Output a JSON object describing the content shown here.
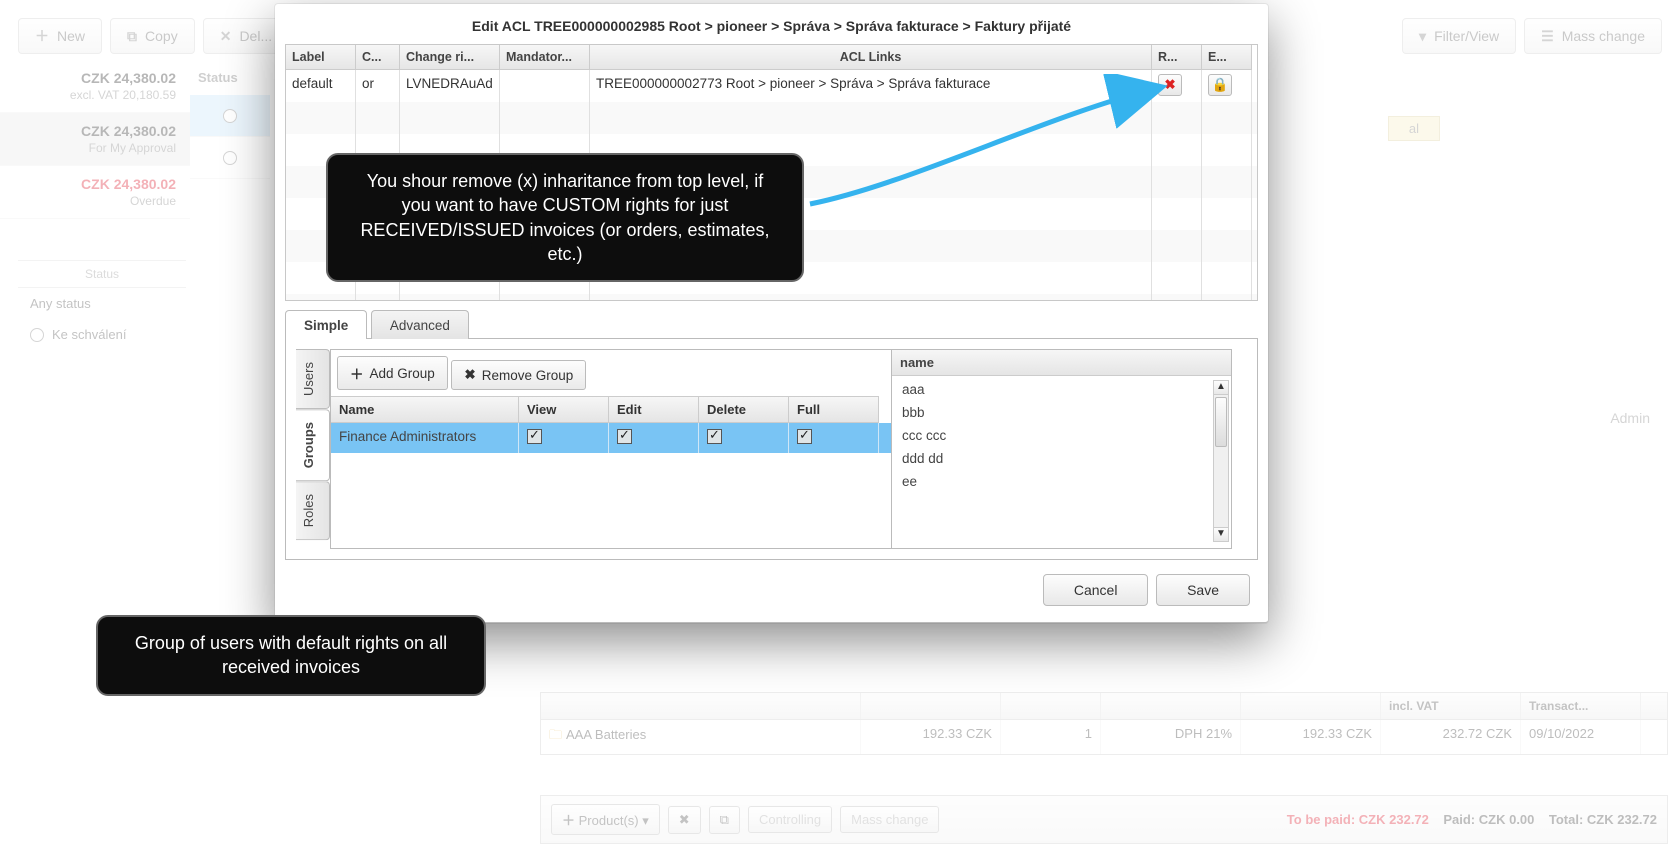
{
  "toolbar": {
    "new": "New",
    "copy": "Copy",
    "del": "Del...",
    "filter": "Filter/View",
    "mass": "Mass change"
  },
  "summaries": [
    {
      "amt": "CZK 24,380.02",
      "sub": "excl. VAT 20,180.59"
    },
    {
      "amt": "CZK 24,380.02",
      "sub": "For My Approval"
    },
    {
      "amt": "CZK 24,380.02",
      "sub": "Overdue",
      "red": true
    }
  ],
  "status_label": "Status",
  "status_filter": {
    "title": "Status",
    "any": "Any status",
    "ke": "Ke schválení"
  },
  "right_bg": {
    "al": "al",
    "admin": "Admin"
  },
  "items": {
    "headers": [
      "",
      "",
      "",
      "",
      "",
      "incl. VAT",
      "Transact..."
    ],
    "row": {
      "name": "AAA Batteries",
      "price": "192.33 CZK",
      "qty": "1",
      "vat": "DPH 21%",
      "total": "192.33 CZK",
      "incl": "232.72 CZK",
      "date": "09/10/2022"
    },
    "foot": {
      "products": "Product(s)",
      "controlling": "Controlling",
      "mass": "Mass change",
      "to_be_paid_label": "To be paid:",
      "to_be_paid": "CZK 232.72",
      "paid_label": "Paid:",
      "paid": "CZK 0.00",
      "total_label": "Total:",
      "total": "CZK 232.72"
    }
  },
  "modal": {
    "title": "Edit ACL TREE000000002985 Root > pioneer > Správa > Správa fakturace > Faktury přijaté",
    "cols": {
      "label": "Label",
      "cond": "C...",
      "change": "Change ri...",
      "mandator": "Mandator...",
      "links": "ACL Links",
      "r": "R...",
      "e": "E..."
    },
    "row": {
      "label": "default",
      "cond": "or",
      "change": "LVNEDRAuAd",
      "mandator": "",
      "links": "TREE000000002773 Root > pioneer > Správa > Správa fakturace"
    },
    "tabs": {
      "simple": "Simple",
      "advanced": "Advanced"
    },
    "vtabs": {
      "users": "Users",
      "groups": "Groups",
      "roles": "Roles"
    },
    "actions": {
      "add": "Add Group",
      "remove": "Remove Group"
    },
    "grp_headers": {
      "name": "Name",
      "view": "View",
      "edit": "Edit",
      "delete": "Delete",
      "full": "Full"
    },
    "grp_row": {
      "name": "Finance Administrators"
    },
    "names_header": "name",
    "names": [
      "aaa",
      "bbb",
      "ccc ccc",
      "ddd dd",
      "ee"
    ],
    "buttons": {
      "cancel": "Cancel",
      "save": "Save"
    }
  },
  "callouts": {
    "top": "You shour remove (x) inharitance from top level, if you want to have CUSTOM rights for just RECEIVED/ISSUED invoices (or orders, estimates, etc.)",
    "bottom": "Group of users with default rights on all received invoices"
  }
}
